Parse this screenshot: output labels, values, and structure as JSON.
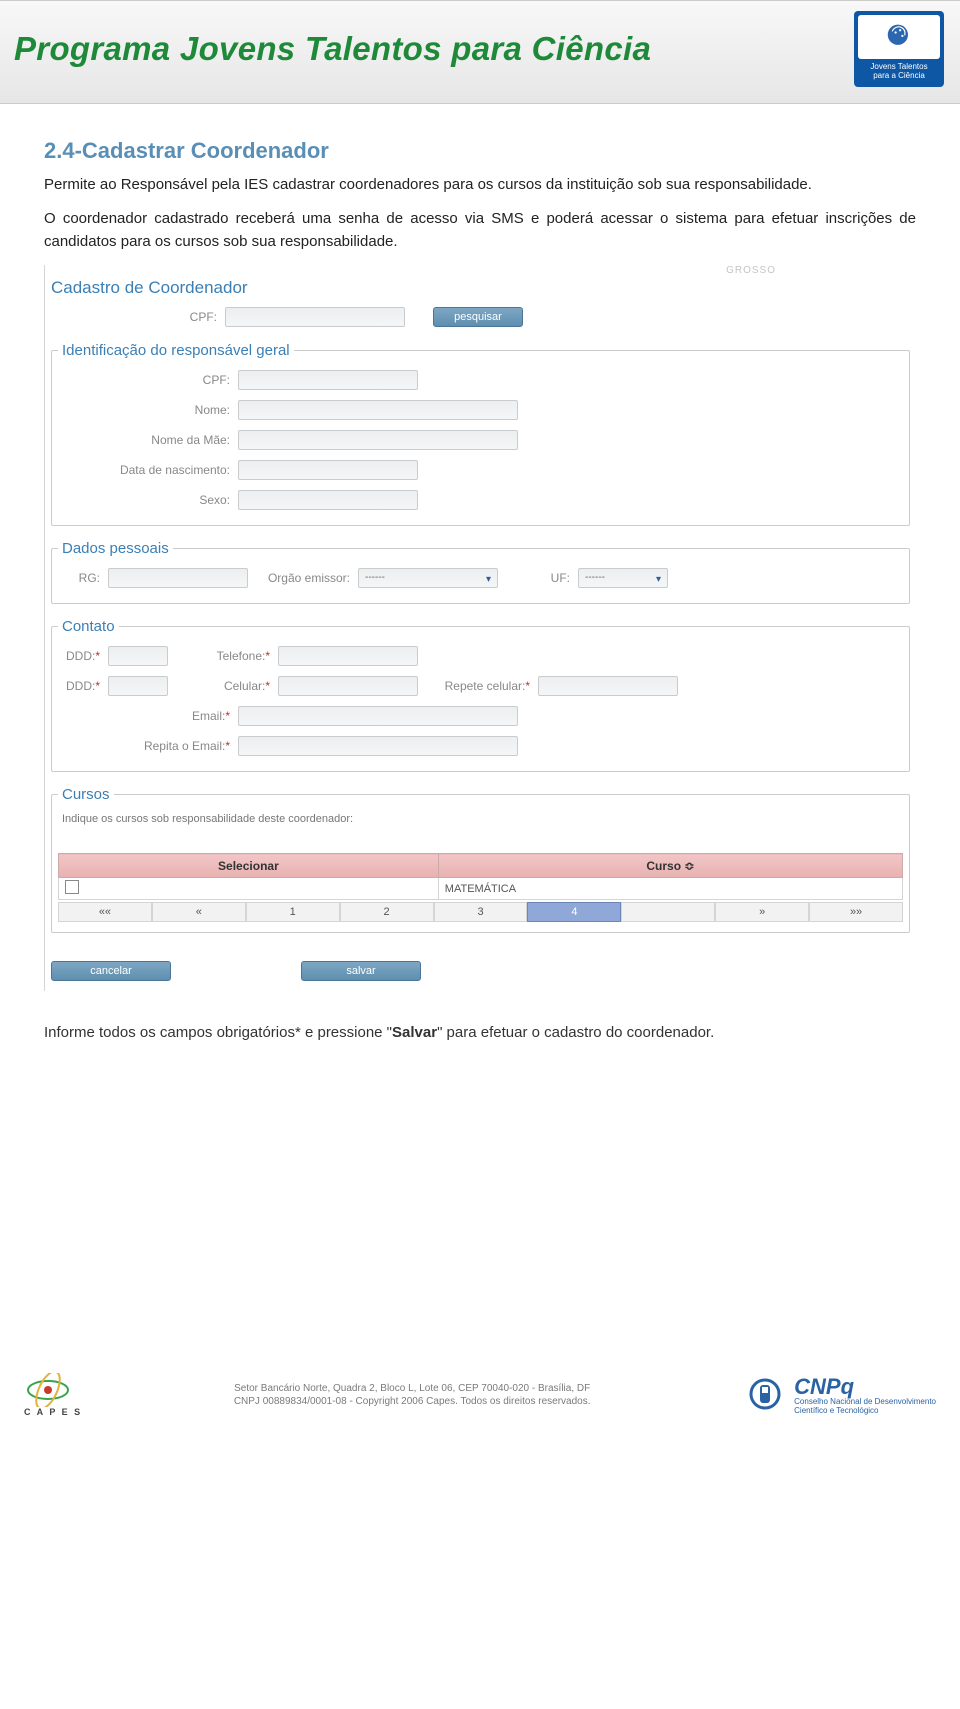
{
  "banner": {
    "title": "Programa Jovens Talentos para Ciência",
    "badge_line1": "Jovens Talentos",
    "badge_line2": "para a Ciência"
  },
  "section": {
    "heading": "2.4-Cadastrar Coordenador",
    "para1": "Permite ao Responsável pela IES cadastrar coordenadores para os cursos da instituição sob sua responsabilidade.",
    "para2": "O coordenador cadastrado receberá uma senha de acesso via SMS e poderá acessar o sistema para efetuar inscrições de candidatos para os cursos sob sua responsabilidade."
  },
  "form": {
    "corner_text": "GROSSO",
    "heading": "Cadastro de Coordenador",
    "cpf_label": "CPF:",
    "search_btn": "pesquisar",
    "ident": {
      "legend": "Identificação do responsável geral",
      "cpf": "CPF:",
      "nome": "Nome:",
      "mae": "Nome da Mãe:",
      "dob": "Data de nascimento:",
      "sexo": "Sexo:"
    },
    "dados": {
      "legend": "Dados pessoais",
      "rg": "RG:",
      "orgao": "Orgão emissor:",
      "orgao_val": "------",
      "uf": "UF:",
      "uf_val": "------"
    },
    "contato": {
      "legend": "Contato",
      "ddd": "DDD:",
      "telefone": "Telefone:",
      "celular": "Celular:",
      "repete_cel": "Repete celular:",
      "email": "Email:",
      "repita_email": "Repita o Email:"
    },
    "cursos": {
      "legend": "Cursos",
      "hint": "Indique os cursos sob responsabilidade deste coordenador:",
      "col_sel": "Selecionar",
      "col_curso": "Curso ≎",
      "row_val": "MATEMÁTICA",
      "pager": [
        "««",
        "«",
        "1",
        "2",
        "3",
        "4",
        "",
        "»",
        "»»"
      ],
      "pager_active_index": 5
    },
    "btn_cancel": "cancelar",
    "btn_save": "salvar"
  },
  "instruction": {
    "pre": "Informe todos os campos obrigatórios* e pressione \"",
    "bold": "Salvar",
    "post": "\" para efetuar o cadastro do coordenador."
  },
  "footer": {
    "capes": "C A P E S",
    "line1": "Setor Bancário Norte, Quadra 2, Bloco L, Lote 06, CEP 70040-020 - Brasília, DF",
    "line2": "CNPJ 00889834/0001-08 - Copyright 2006 Capes. Todos os direitos reservados.",
    "cnpq_name": "CNPq",
    "cnpq_sub1": "Conselho Nacional de Desenvolvimento",
    "cnpq_sub2": "Científico e Tecnológico"
  }
}
